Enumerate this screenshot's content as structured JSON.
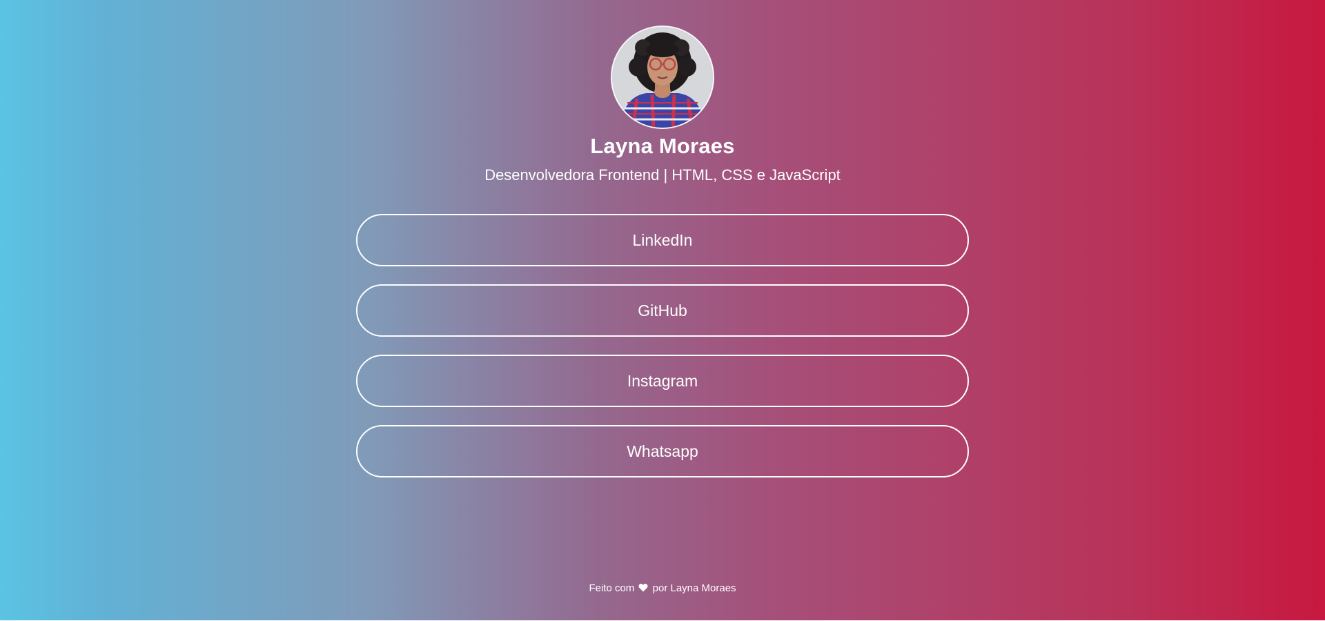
{
  "profile": {
    "name": "Layna Moraes",
    "subtitle": "Desenvolvedora Frontend | HTML, CSS e JavaScript",
    "avatar_icon": "profile-photo"
  },
  "links": [
    {
      "label": "LinkedIn"
    },
    {
      "label": "GitHub"
    },
    {
      "label": "Instagram"
    },
    {
      "label": "Whatsapp"
    }
  ],
  "footer": {
    "prefix": "Feito com",
    "icon": "heart-icon",
    "suffix": "por Layna Moraes"
  },
  "colors": {
    "gradient_left": "#5bc3e4",
    "gradient_right": "#c8183f",
    "text": "#ffffff",
    "button_border": "#ffffff"
  }
}
